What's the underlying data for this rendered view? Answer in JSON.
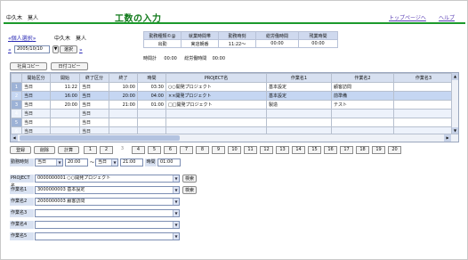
{
  "header": {
    "user": "中久木　莫人",
    "title": "工数の入力",
    "links": [
      "トップページへ",
      "ヘルプ"
    ]
  },
  "personal_select": "個人選択",
  "personal_name": "中久木　莫人",
  "date": {
    "value": "2005/10/10",
    "select": "選択"
  },
  "copy_buttons": [
    "社員コピー",
    "日付コピー"
  ],
  "summary": {
    "headers": [
      "勤務種類©@",
      "就業時間帯",
      "勤務時刻",
      "総労働時間",
      "残業時間"
    ],
    "values": [
      "出勤",
      "実店朝番",
      "11:22～",
      "00:00",
      "00:00"
    ]
  },
  "time_total": {
    "label": "時間計",
    "value": "00:00",
    "labor_label": "総労働時間",
    "labor_value": "00:00"
  },
  "grid": {
    "headers": [
      "開始区分",
      "開始",
      "終了区分",
      "終了",
      "時間",
      "PROJECT名",
      "作業名1",
      "作業名2",
      "作業名3"
    ],
    "rows": [
      {
        "n": "1",
        "sk": "当日",
        "st": "11:22",
        "ek": "当日",
        "et": "10:00",
        "tm": "03:30",
        "proj": "○○開発プロジェクト",
        "w1": "基本設定",
        "w2": "顧客訪問",
        "w3": ""
      },
      {
        "n": "2",
        "sk": "当日",
        "st": "16:00",
        "ek": "当日",
        "et": "20:00",
        "tm": "04:00",
        "proj": "××開発プロジェクト",
        "w1": "基本設定",
        "w2": "前準備",
        "w3": ""
      },
      {
        "n": "3",
        "sk": "当日",
        "st": "20:00",
        "ek": "当日",
        "et": "21:00",
        "tm": "01:00",
        "proj": "□□開発プロジェクト",
        "w1": "製造",
        "w2": "テスト",
        "w3": ""
      },
      {
        "n": "4",
        "sk": "当日",
        "st": "",
        "ek": "当日",
        "et": "",
        "tm": "",
        "proj": "",
        "w1": "",
        "w2": "",
        "w3": ""
      },
      {
        "n": "5",
        "sk": "当日",
        "st": "",
        "ek": "当日",
        "et": "",
        "tm": "",
        "proj": "",
        "w1": "",
        "w2": "",
        "w3": ""
      },
      {
        "n": "6",
        "sk": "当日",
        "st": "",
        "ek": "当日",
        "et": "",
        "tm": "",
        "proj": "",
        "w1": "",
        "w2": "",
        "w3": ""
      }
    ]
  },
  "actions": {
    "register": "登録",
    "delete": "削除",
    "calc": "計算"
  },
  "pages": [
    "1",
    "2",
    "3",
    "4",
    "5",
    "6",
    "7",
    "8",
    "9",
    "10",
    "11",
    "12",
    "13",
    "14",
    "15",
    "16",
    "17",
    "18",
    "19",
    "20"
  ],
  "work_time": {
    "label": "勤務時刻",
    "start_kubun": "当日",
    "start": "20:00",
    "sep": "～",
    "end_kubun": "当日",
    "end": "21:00",
    "time_label": "時間",
    "time": "01:00"
  },
  "fields": [
    {
      "label": "PROJECT名",
      "code": "0000000001",
      "name": "○○開発プロジェクト",
      "search": "検索"
    },
    {
      "label": "作業名1",
      "code": "3000000003",
      "name": "基本設定",
      "search": "検索"
    },
    {
      "label": "作業名2",
      "code": "2000000003",
      "name": "顧客訪問",
      "search": ""
    },
    {
      "label": "作業名3",
      "code": "",
      "name": "",
      "search": ""
    },
    {
      "label": "作業名4",
      "code": "",
      "name": "",
      "search": ""
    },
    {
      "label": "作業名5",
      "code": "",
      "name": "",
      "search": ""
    }
  ]
}
